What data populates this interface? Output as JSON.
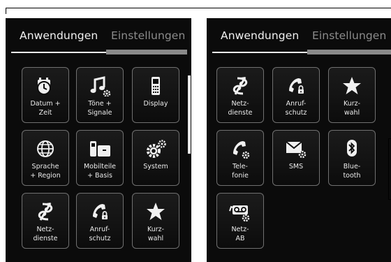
{
  "left": {
    "tabs": {
      "active": "Anwendungen",
      "inactive": "Einstellungen"
    },
    "tiles": [
      {
        "id": "datum-zeit",
        "icon": "calendar-clock-icon",
        "label": [
          "Datum +",
          "Zeit"
        ]
      },
      {
        "id": "toene-signale",
        "icon": "music-note-settings-icon",
        "label": [
          "Töne +",
          "Signale"
        ]
      },
      {
        "id": "display",
        "icon": "handset-display-icon",
        "label": [
          "Display"
        ]
      },
      {
        "id": "sprache-region",
        "icon": "globe-icon",
        "label": [
          "Sprache",
          "+ Region"
        ]
      },
      {
        "id": "mobilteile-basis",
        "icon": "handset-base-icon",
        "label": [
          "Mobilteile",
          "+ Basis"
        ]
      },
      {
        "id": "system",
        "icon": "gears-icon",
        "label": [
          "System"
        ]
      },
      {
        "id": "netzdienste",
        "icon": "network-services-icon",
        "label": [
          "Netz-",
          "dienste"
        ]
      },
      {
        "id": "anrufschutz",
        "icon": "phone-lock-icon",
        "label": [
          "Anruf-",
          "schutz"
        ]
      },
      {
        "id": "kurzwahl",
        "icon": "star-icon",
        "label": [
          "Kurz-",
          "wahl"
        ]
      }
    ]
  },
  "right": {
    "tabs": {
      "active": "Anwendungen",
      "inactive": "Einstellungen"
    },
    "tiles": [
      {
        "id": "netzdienste",
        "icon": "network-services-icon",
        "label": [
          "Netz-",
          "dienste"
        ]
      },
      {
        "id": "anrufschutz",
        "icon": "phone-lock-icon",
        "label": [
          "Anruf-",
          "schutz"
        ]
      },
      {
        "id": "kurzwahl",
        "icon": "star-icon",
        "label": [
          "Kurz-",
          "wahl"
        ]
      },
      {
        "id": "telefonie",
        "icon": "phone-settings-icon",
        "label": [
          "Tele-",
          "fonie"
        ]
      },
      {
        "id": "sms",
        "icon": "envelope-settings-icon",
        "label": [
          "SMS"
        ]
      },
      {
        "id": "bluetooth",
        "icon": "bluetooth-icon",
        "label": [
          "Blue-",
          "tooth"
        ]
      },
      {
        "id": "netz-ab",
        "icon": "voicemail-settings-icon",
        "label": [
          "Netz-",
          "AB"
        ]
      }
    ]
  }
}
